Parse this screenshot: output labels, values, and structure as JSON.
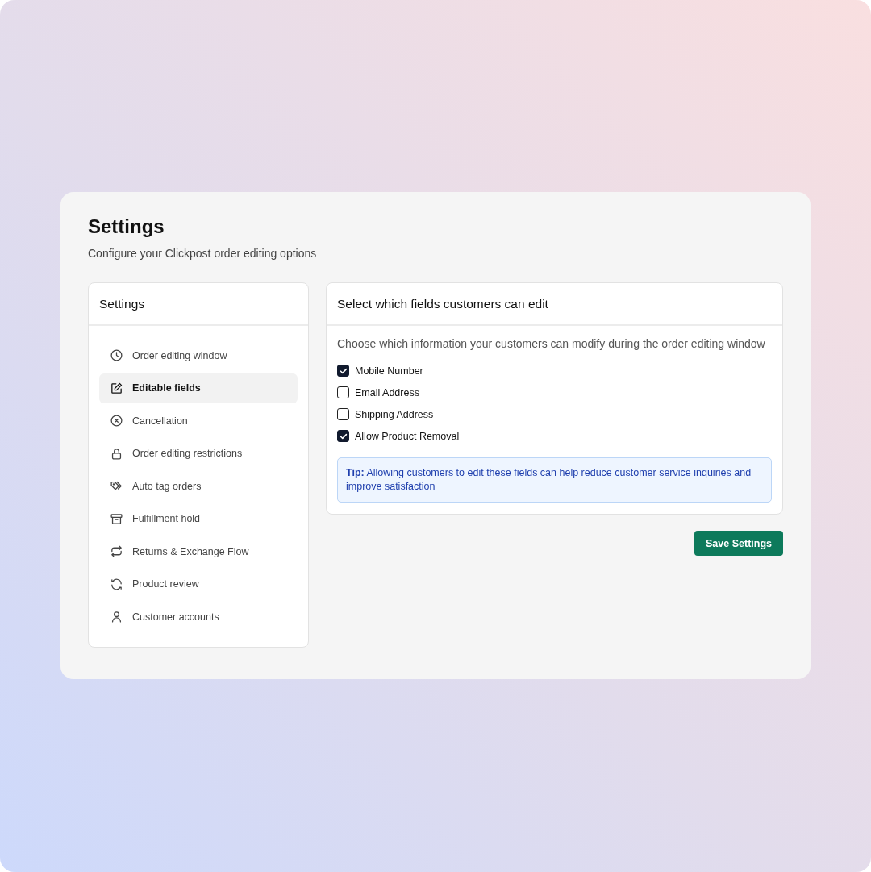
{
  "header": {
    "title": "Settings",
    "subtitle": "Configure your Clickpost order editing options"
  },
  "sidebar": {
    "title": "Settings",
    "items": [
      {
        "label": "Order editing window",
        "selected": false
      },
      {
        "label": "Editable fields",
        "selected": true
      },
      {
        "label": "Cancellation",
        "selected": false
      },
      {
        "label": "Order editing restrictions",
        "selected": false
      },
      {
        "label": "Auto tag orders",
        "selected": false
      },
      {
        "label": "Fulfillment hold",
        "selected": false
      },
      {
        "label": "Returns & Exchange Flow",
        "selected": false
      },
      {
        "label": "Product review",
        "selected": false
      },
      {
        "label": "Customer accounts",
        "selected": false
      }
    ]
  },
  "panel": {
    "title": "Select which fields customers can edit",
    "description": "Choose which information your customers can modify during the order editing window",
    "fields": [
      {
        "label": "Mobile Number",
        "checked": true
      },
      {
        "label": "Email Address",
        "checked": false
      },
      {
        "label": "Shipping Address",
        "checked": false
      },
      {
        "label": "Allow Product Removal",
        "checked": true
      }
    ],
    "tip": "**Tip:** Allowing customers to edit these fields can help reduce customer service inquiries and improve satisfaction"
  },
  "save_button": "Save Settings"
}
